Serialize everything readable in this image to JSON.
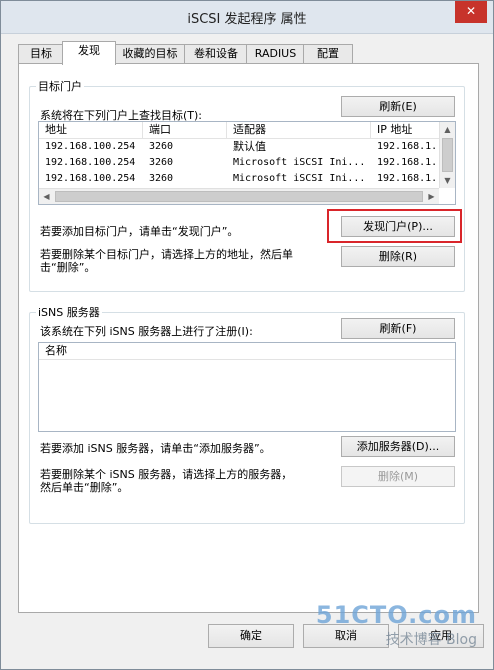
{
  "window": {
    "title": "iSCSI 发起程序 属性",
    "close_glyph": "✕"
  },
  "tabs": [
    "目标",
    "发现",
    "收藏的目标",
    "卷和设备",
    "RADIUS",
    "配置"
  ],
  "portal_group": {
    "legend": "目标门户",
    "description": "系统将在下列门户上查找目标(T):",
    "refresh_label": "刷新(E)",
    "columns": [
      "地址",
      "端口",
      "适配器",
      "IP 地址"
    ],
    "rows": [
      [
        "192.168.100.254",
        "3260",
        "默认值",
        "192.168.1."
      ],
      [
        "192.168.100.254",
        "3260",
        "Microsoft iSCSI Ini...",
        "192.168.1."
      ],
      [
        "192.168.100.254",
        "3260",
        "Microsoft iSCSI Ini...",
        "192.168.1."
      ]
    ],
    "add_hint": "若要添加目标门户，请单击“发现门户”。",
    "discover_label": "发现门户(P)...",
    "remove_hint_line1": "若要删除某个目标门户，请选择上方的地址，然后单",
    "remove_hint_line2": "击“删除”。",
    "remove_label": "删除(R)"
  },
  "isns_group": {
    "legend": "iSNS 服务器",
    "description": "该系统在下列 iSNS 服务器上进行了注册(I):",
    "refresh_label": "刷新(F)",
    "column": "名称",
    "add_hint": "若要添加 iSNS 服务器，请单击“添加服务器”。",
    "add_label": "添加服务器(D)...",
    "remove_hint_line1": "若要删除某个 iSNS 服务器，请选择上方的服务器，",
    "remove_hint_line2": "然后单击“删除”。",
    "remove_label": "删除(M)"
  },
  "footer": {
    "ok_label": "确定",
    "cancel_label": "取消",
    "apply_label": "应用"
  },
  "watermark": {
    "main": "51CTO.com",
    "sub": "技术博客",
    "tag": "Blog"
  },
  "colors": {
    "highlight": "#d9252a",
    "close": "#c7332b"
  }
}
